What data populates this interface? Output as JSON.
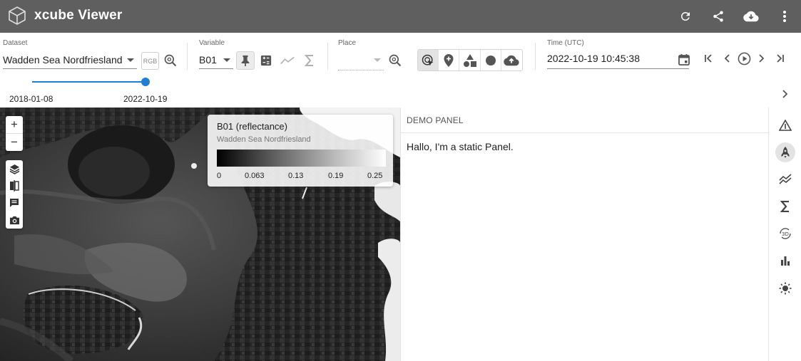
{
  "app": {
    "title": "xcube Viewer"
  },
  "header": {
    "buttons": [
      {
        "name": "refresh",
        "icon": "refresh-icon"
      },
      {
        "name": "share",
        "icon": "share-icon"
      },
      {
        "name": "download",
        "icon": "cloud-download-icon"
      },
      {
        "name": "menu",
        "icon": "more-vert-icon"
      }
    ]
  },
  "controls": {
    "dataset": {
      "label": "Dataset",
      "value": "Wadden Sea Nordfriesland",
      "rgb_label": "RGB"
    },
    "variable": {
      "label": "Variable",
      "value": "B01"
    },
    "place": {
      "label": "Place",
      "value": ""
    },
    "time": {
      "label": "Time (UTC)",
      "value": "2022-10-19 10:45:38"
    },
    "time_range": {
      "start": "2018-01-08",
      "end": "2022-10-19",
      "position": 1.0
    }
  },
  "map": {
    "zoom_in": "+",
    "zoom_out": "−",
    "legend": {
      "title": "B01 (reflectance)",
      "subtitle": "Wadden Sea Nordfriesland",
      "ticks": [
        "0",
        "0.063",
        "0.13",
        "0.19",
        "0.25"
      ]
    }
  },
  "panel": {
    "header": "DEMO PANEL",
    "body": "Hallo, I'm a static Panel."
  },
  "colors": {
    "header_bg": "#5f5f5f",
    "accent": "#1f7fd6",
    "selected_bg": "#e3e3e3"
  }
}
